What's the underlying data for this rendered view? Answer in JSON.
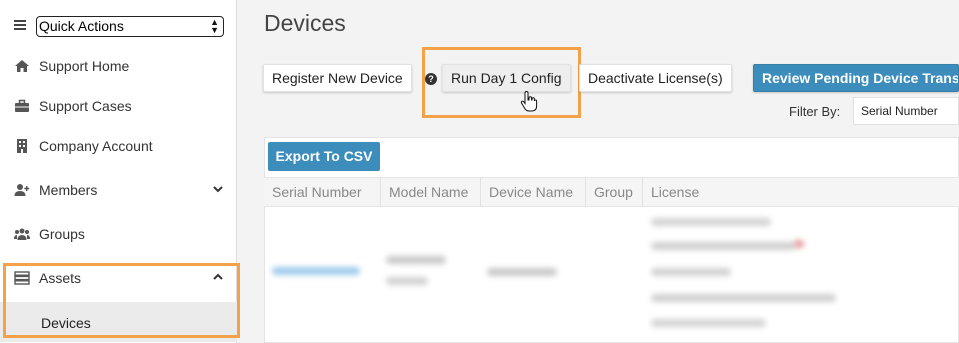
{
  "sidebar": {
    "quick_actions": "Quick Actions",
    "items": [
      {
        "label": "Support Home",
        "icon": "home-icon"
      },
      {
        "label": "Support Cases",
        "icon": "briefcase-icon"
      },
      {
        "label": "Company Account",
        "icon": "building-icon"
      },
      {
        "label": "Members",
        "icon": "user-plus-icon"
      },
      {
        "label": "Groups",
        "icon": "users-icon"
      },
      {
        "label": "Assets",
        "icon": "server-icon"
      }
    ],
    "sub_item": "Devices"
  },
  "main": {
    "title": "Devices",
    "toolbar": {
      "register": "Register New Device",
      "run_config": "Run Day 1 Config",
      "deactivate": "Deactivate License(s)",
      "review": "Review Pending Device Transf"
    },
    "filter": {
      "label": "Filter By:",
      "value": "Serial Number"
    },
    "export": "Export To CSV",
    "columns": [
      "Serial Number",
      "Model Name",
      "Device Name",
      "Group",
      "License"
    ]
  },
  "colors": {
    "accent": "#3c8dbc",
    "highlight": "#f3a24a"
  }
}
